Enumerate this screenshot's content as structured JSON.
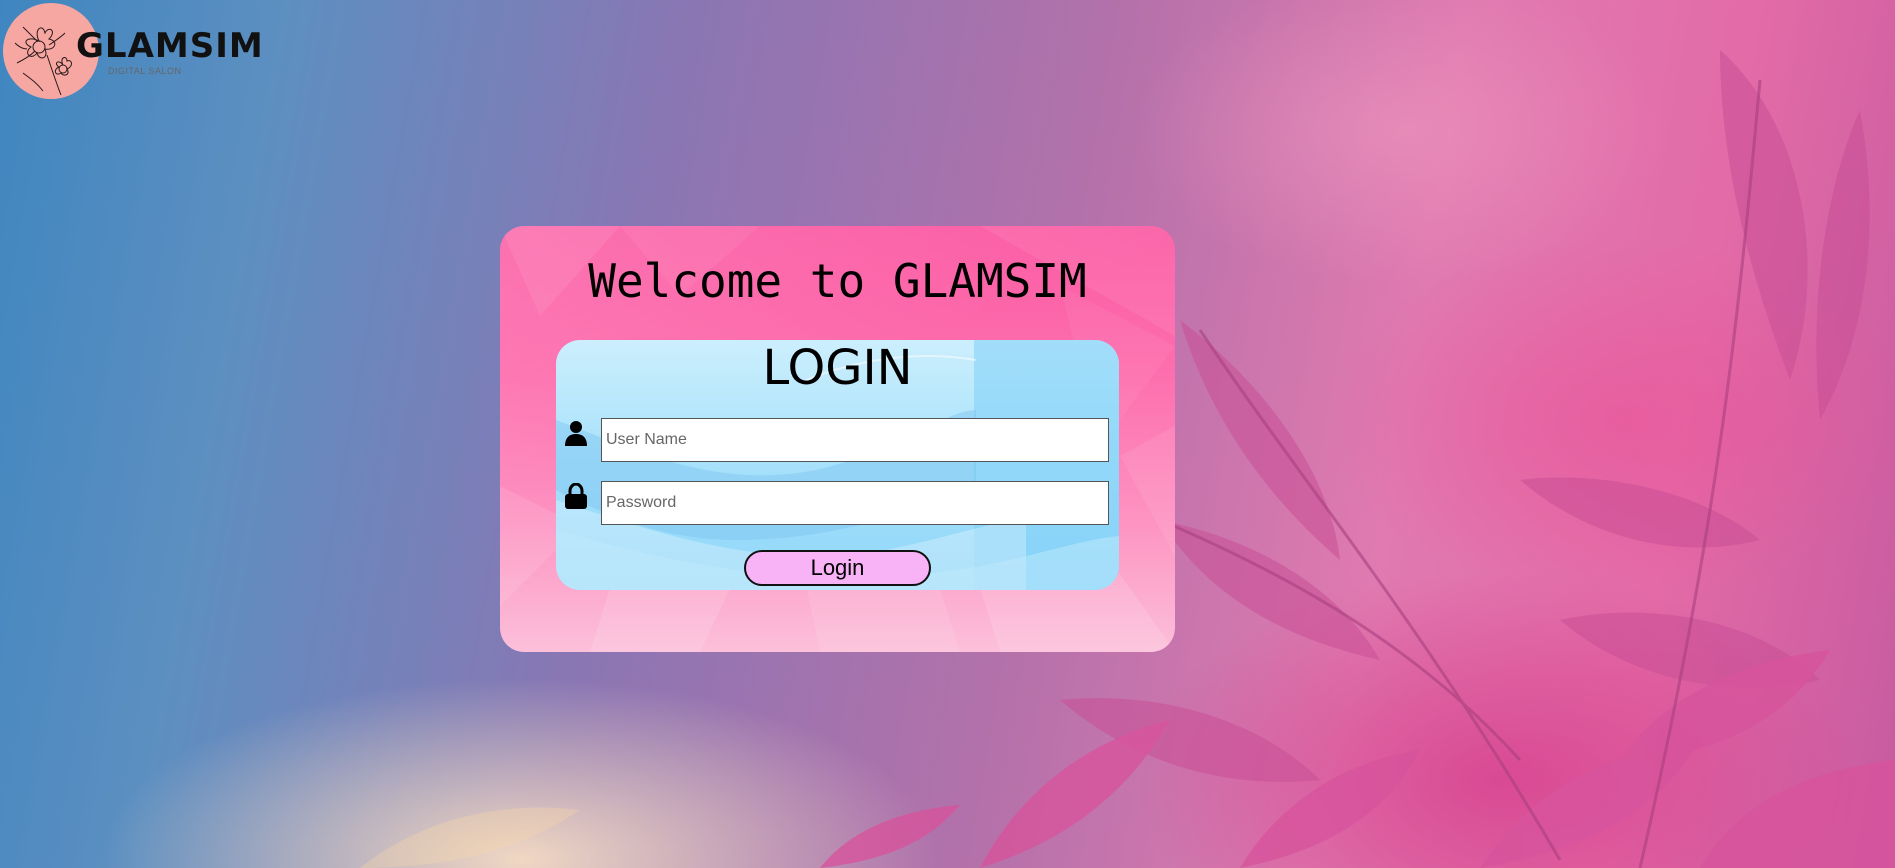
{
  "brand": {
    "name": "GLAMSIM",
    "tagline": "DIGITAL SALON",
    "logo_color": "#f6a7a2"
  },
  "card": {
    "title": "Welcome to GLAMSIM"
  },
  "login": {
    "heading": "LOGIN",
    "username": {
      "placeholder": "User Name",
      "value": "",
      "icon": "user-icon"
    },
    "password": {
      "placeholder": "Password",
      "value": "",
      "icon": "lock-icon"
    },
    "button_label": "Login",
    "button_color": "#f8b2f6"
  },
  "colors": {
    "card_pink": "#fb5aa3",
    "panel_blue": "#a9e2fb"
  }
}
